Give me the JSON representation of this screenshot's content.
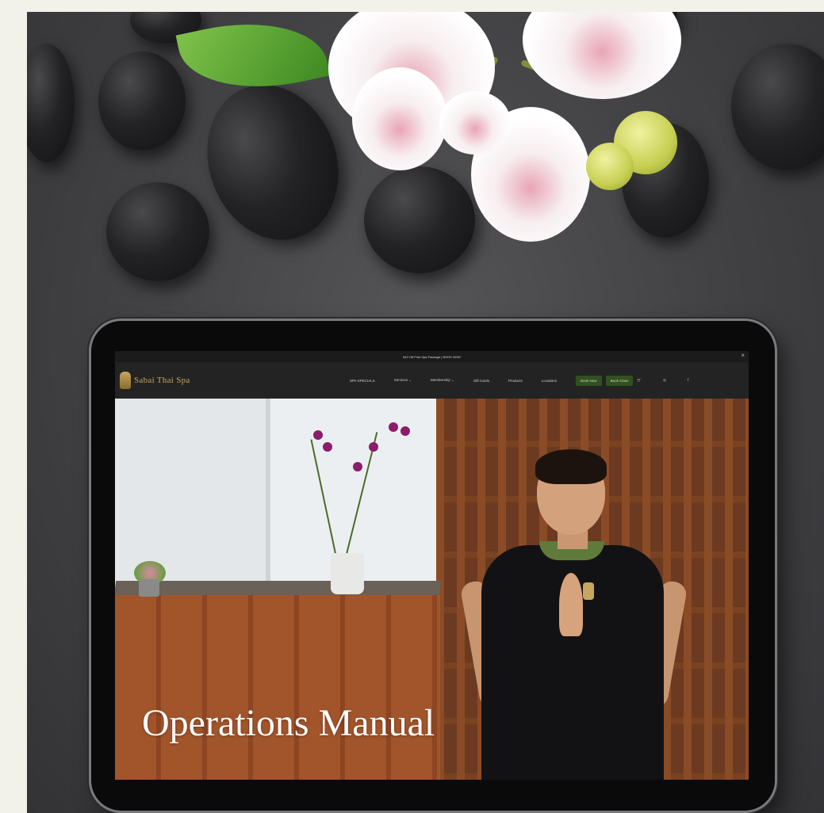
{
  "announcement": {
    "text": "$10 Off First Spa Package | BOOK NOW",
    "close_label": "×"
  },
  "site": {
    "brand_name": "Sabai Thai Spa"
  },
  "nav": {
    "items": [
      "SPA SPECIALS",
      "Services ⌄",
      "Membership ⌄",
      "Gift Cards",
      "Products",
      "Locations"
    ],
    "buttons": [
      "Book Now",
      "Book Class"
    ],
    "icons": [
      "cart-icon",
      "instagram-icon",
      "facebook-icon"
    ]
  },
  "hero": {
    "title": "Operations Manual"
  },
  "colors": {
    "page_bg": "#f3f2ea",
    "nav_bg": "#232323",
    "brand_gold": "#c9a55e",
    "button_green": "#31511f"
  }
}
